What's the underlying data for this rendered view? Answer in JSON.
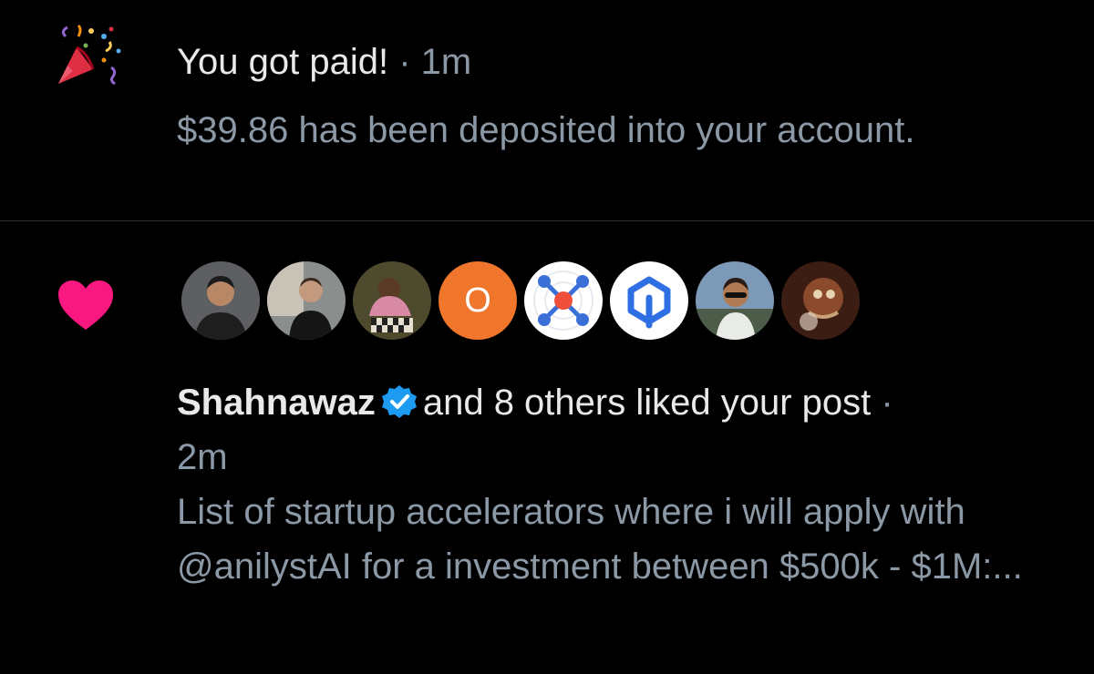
{
  "payment": {
    "icon": "party-popper-icon",
    "title": "You got paid!",
    "separator": "·",
    "time": "1m",
    "body": "$39.86 has been deposited into your account."
  },
  "like": {
    "icon": "heart-icon",
    "icon_color": "#f91880",
    "avatars": [
      "avatar-1",
      "avatar-2",
      "avatar-3",
      "avatar-o",
      "avatar-network-logo",
      "avatar-q-logo",
      "avatar-7",
      "avatar-8"
    ],
    "avatar_letter": "O",
    "user": "Shahnawaz",
    "verified_color": "#1d9bf0",
    "action": "and 8 others liked your post",
    "separator": "·",
    "time": "2m",
    "post_preview": "List of startup accelerators where i will apply with @anilystAI for a investment between $500k - $1M:..."
  },
  "colors": {
    "background": "#000000",
    "text": "#e7e9ea",
    "muted": "#8b98a5",
    "divider": "#2f3336"
  }
}
